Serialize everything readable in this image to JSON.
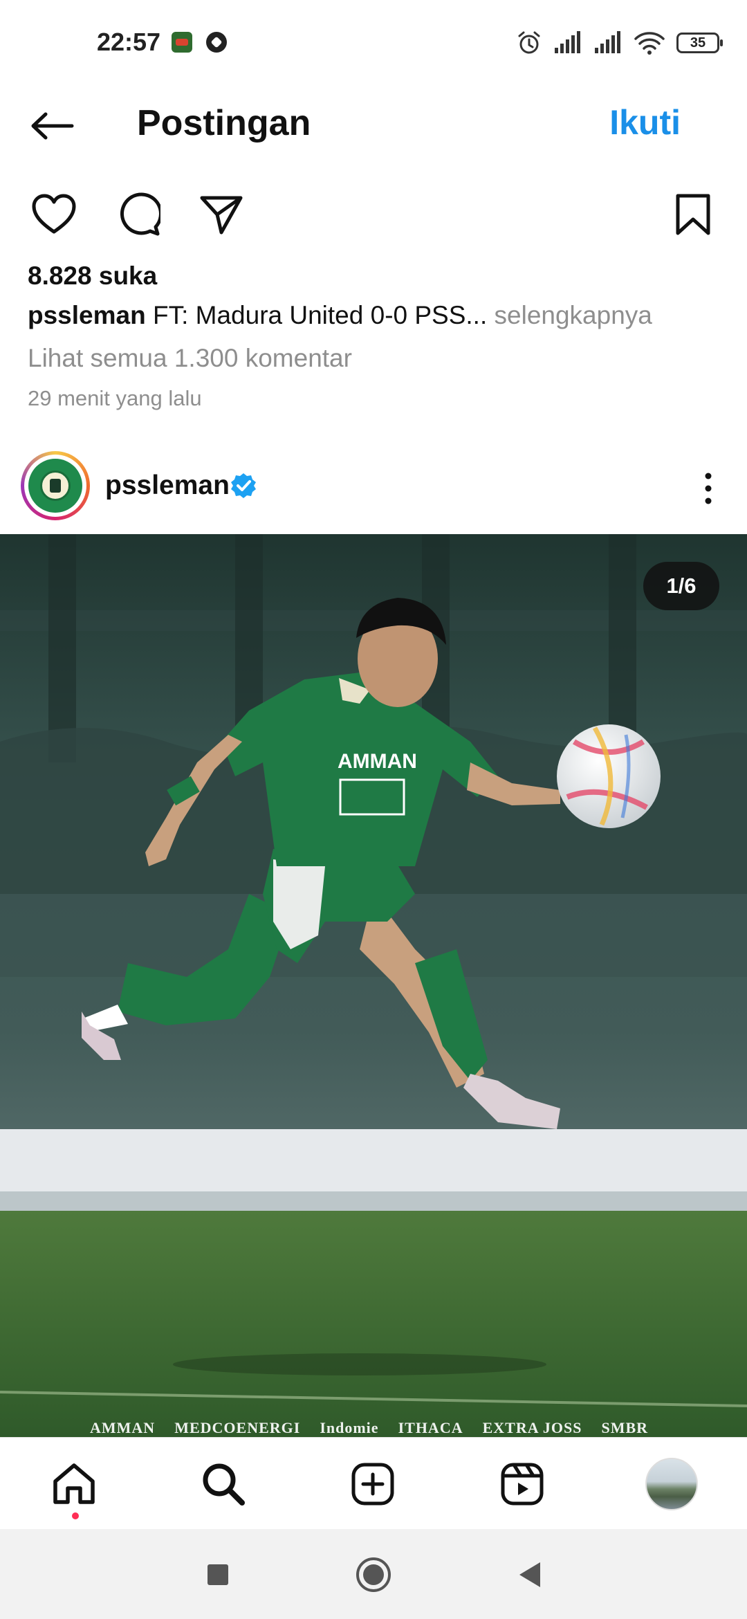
{
  "status_bar": {
    "time": "22:57",
    "battery": "35",
    "icons": [
      "notification-app-icon",
      "soccer-ball-icon",
      "alarm-icon",
      "signal-icon",
      "signal-icon",
      "wifi-icon",
      "battery-icon"
    ]
  },
  "header": {
    "title": "Postingan",
    "follow_label": "Ikuti",
    "back_icon": "back-arrow-icon"
  },
  "actions": {
    "icons": [
      "heart-icon",
      "comment-icon",
      "share-icon",
      "bookmark-icon"
    ]
  },
  "post": {
    "likes": "8.828 suka",
    "username": "pssleman",
    "caption": "FT: Madura United 0-0 PSS...",
    "more_label": "selengkapnya",
    "comments_link": "Lihat semua 1.300 komentar",
    "time_ago": "29 menit yang lalu"
  },
  "post_header": {
    "username": "pssleman",
    "verified": true
  },
  "photo": {
    "counter": "1/6",
    "sponsors": [
      "AMMAN",
      "MEDCOENERGI",
      "Indomie",
      "ITHACA",
      "EXTRA JOSS",
      "SMBR"
    ]
  },
  "bottom_nav": {
    "items": [
      "home-icon",
      "search-icon",
      "create-icon",
      "reels-icon",
      "profile-avatar"
    ],
    "active": "home"
  },
  "colors": {
    "accent": "#1a8fe8",
    "verified": "#1da1f2",
    "notification_dot": "#ff2d55",
    "jersey": "#1f7a45"
  }
}
